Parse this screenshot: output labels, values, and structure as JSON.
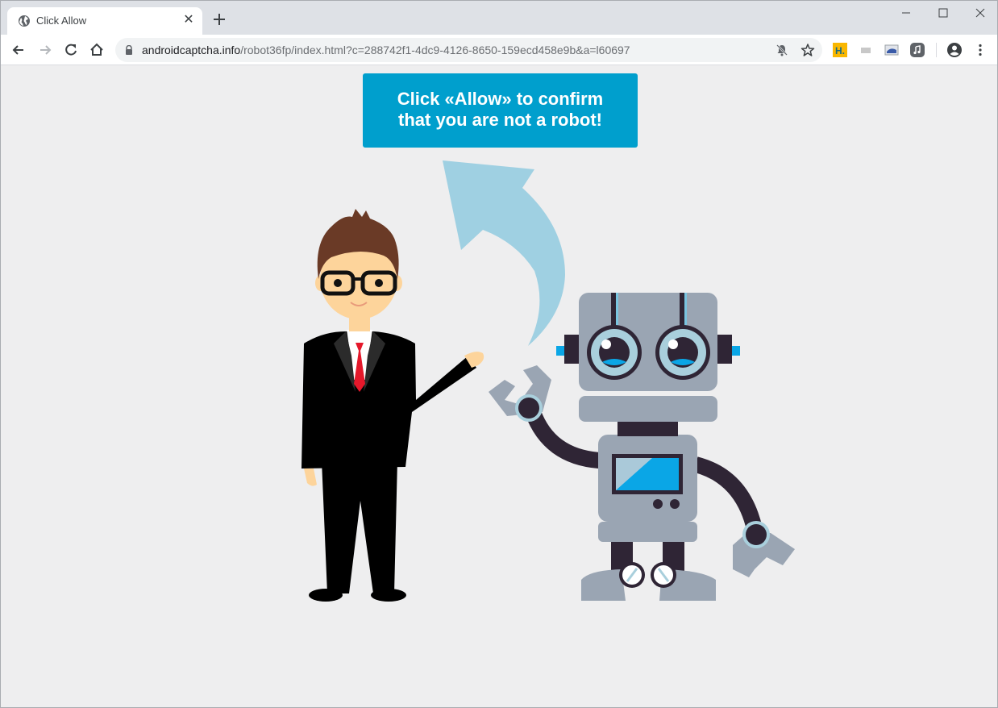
{
  "browser": {
    "tab": {
      "title": "Click Allow",
      "favicon": "globe-icon",
      "close_glyph": "✕"
    },
    "new_tab_icon": "plus-icon",
    "window_controls": [
      "minimize-icon",
      "maximize-icon",
      "close-icon"
    ],
    "nav": [
      "back-icon",
      "forward-icon",
      "reload-icon",
      "home-icon"
    ],
    "address": {
      "host": "androidcaptcha.info",
      "path": "/robot36fp/index.html?c=288742f1-4dc9-4126-8650-159ecd458e9b&a=l60697",
      "secure_icon": "lock-icon"
    },
    "omnibox_icons": [
      "notifications-blocked-icon",
      "bookmark-star-icon"
    ],
    "extensions": [
      {
        "name": "h-extension-icon",
        "label": "H.",
        "color": "#f9b700"
      },
      {
        "name": "mail-extension-icon",
        "label": "",
        "color": "#c8c8c8"
      },
      {
        "name": "image-extension-icon",
        "label": "",
        "color": "#3a5ba8"
      },
      {
        "name": "music-extension-icon",
        "label": "♫",
        "color": "#5f6368"
      }
    ],
    "profile_icon": "account-circle-icon",
    "menu_icon": "kebab-menu-icon"
  },
  "page": {
    "cta": {
      "line1": "Click «Allow» to confirm",
      "line2": "that you are not a robot!",
      "color": "#009fcd"
    },
    "illustration": {
      "man": "businessman-illustration",
      "robot": "robot-illustration",
      "arrow": "curved-arrow-up-icon",
      "arrow_color": "#9fd0e2"
    }
  }
}
